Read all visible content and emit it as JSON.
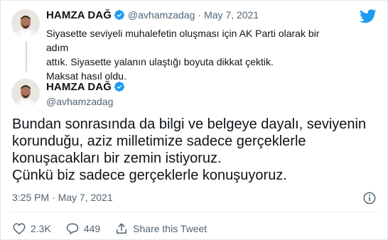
{
  "colors": {
    "accent": "#1d9bf0",
    "muted": "#536471",
    "text": "#0f1419",
    "heart": "#e0245e"
  },
  "quoted_tweet": {
    "author_name": "HAMZA DAĞ",
    "handle": "@avhamzadag",
    "separator": "·",
    "date": "May 7, 2021",
    "text_lines": [
      "Siyasette seviyeli muhalefetin oluşması için AK Parti olarak bir adım",
      "attık. Siyasette yalanın ulaştığı boyuta dikkat çektik.",
      "Maksat hasıl oldu."
    ],
    "icons": {
      "verified": "verified-badge-icon",
      "logo": "twitter-bird-icon"
    }
  },
  "main_tweet": {
    "author_name": "HAMZA DAĞ",
    "handle": "@avhamzadag",
    "text_lines": [
      "Bundan sonrasında da bilgi ve belgeye dayalı, seviyenin",
      "korunduğu, aziz milletimize sadece gerçeklerle",
      "konuşacakları bir zemin istiyoruz.",
      "Çünkü biz sadece gerçeklerle konuşuyoruz."
    ],
    "timestamp": "3:25 PM · May 7, 2021"
  },
  "actions": {
    "likes": "2.3K",
    "replies": "449",
    "share_label": "Share this Tweet"
  }
}
